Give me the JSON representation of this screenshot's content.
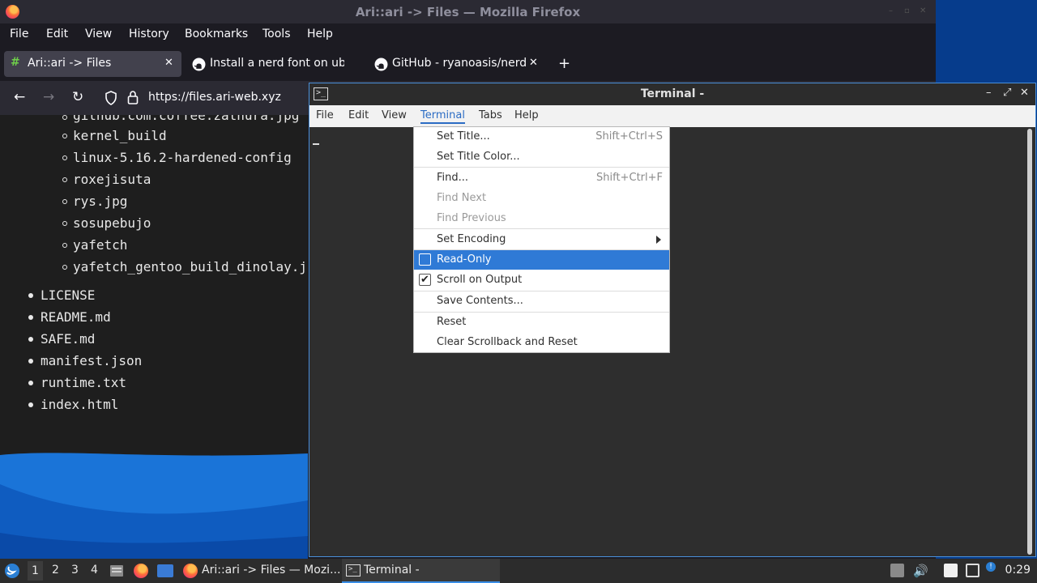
{
  "firefox": {
    "window_title": "Ari::ari -> Files — Mozilla Firefox",
    "menu": [
      "File",
      "Edit",
      "View",
      "History",
      "Bookmarks",
      "Tools",
      "Help"
    ],
    "tabs": [
      {
        "label": "Ari::ari -> Files",
        "active": true
      },
      {
        "label": "Install a nerd font on ubu",
        "active": false
      },
      {
        "label": "GitHub - ryanoasis/nerd-f",
        "active": false
      }
    ],
    "new_tab": "+",
    "url": "https://files.ari-web.xyz",
    "page": {
      "nested_items": [
        "github.com.coffee.zathura.jpg",
        "kernel_build",
        "linux-5.16.2-hardened-config",
        "roxejisuta",
        "rys.jpg",
        "sosupebujo",
        "yafetch",
        "yafetch_gentoo_build_dinolay.j"
      ],
      "top_items": [
        "LICENSE",
        "README.md",
        "SAFE.md",
        "manifest.json",
        "runtime.txt",
        "index.html"
      ]
    }
  },
  "terminal": {
    "title": "Terminal -",
    "menu": [
      "File",
      "Edit",
      "View",
      "Terminal",
      "Tabs",
      "Help"
    ],
    "active_menu": "Terminal",
    "dropdown": {
      "set_title": {
        "label": "Set Title...",
        "accel": "Shift+Ctrl+S"
      },
      "set_title_color": {
        "label": "Set Title Color..."
      },
      "find": {
        "label": "Find...",
        "accel": "Shift+Ctrl+F"
      },
      "find_next": {
        "label": "Find Next"
      },
      "find_previous": {
        "label": "Find Previous"
      },
      "set_encoding": {
        "label": "Set Encoding"
      },
      "read_only": {
        "label": "Read-Only",
        "checked": false
      },
      "scroll_on_output": {
        "label": "Scroll on Output",
        "checked": true
      },
      "save_contents": {
        "label": "Save Contents..."
      },
      "reset": {
        "label": "Reset"
      },
      "clear_scrollback": {
        "label": "Clear Scrollback and Reset"
      }
    }
  },
  "taskbar": {
    "workspaces": [
      "1",
      "2",
      "3",
      "4"
    ],
    "active_workspace": "1",
    "tasks": [
      {
        "label": "Ari::ari -> Files — Mozi...",
        "icon": "firefox-icon"
      },
      {
        "label": "Terminal -",
        "icon": "terminal-icon",
        "active": true
      }
    ],
    "clock": "0:29"
  },
  "colors": {
    "highlight": "#2f7ad6",
    "menu_active": "#2b6cc4",
    "desktop": "#0a3f8c"
  }
}
